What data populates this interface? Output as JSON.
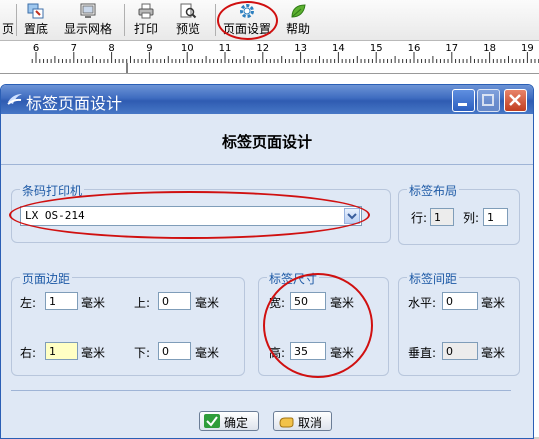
{
  "toolbar": {
    "items": [
      {
        "label": "页"
      },
      {
        "label": "置底"
      },
      {
        "label": "显示网格"
      },
      {
        "label": "打印"
      },
      {
        "label": "预览"
      },
      {
        "label": "页面设置"
      },
      {
        "label": "帮助"
      }
    ]
  },
  "ruler": {
    "numbers": [
      "6",
      "7",
      "8",
      "9",
      "10",
      "11",
      "12",
      "13",
      "14",
      "15",
      "16",
      "17",
      "18",
      "19"
    ]
  },
  "dialog": {
    "title": "标签页面设计",
    "header": "标签页面设计",
    "printer": {
      "title": "条码打印机",
      "selected": "LX OS-214"
    },
    "layout": {
      "title": "标签布局",
      "row_label": "行:",
      "row_value": "1",
      "col_label": "列:",
      "col_value": "1"
    },
    "margins": {
      "title": "页面边距",
      "left_label": "左:",
      "left_value": "1",
      "top_label": "上:",
      "top_value": "0",
      "right_label": "右:",
      "right_value": "1",
      "bottom_label": "下:",
      "bottom_value": "0",
      "unit": "毫米"
    },
    "size": {
      "title": "标签尺寸",
      "width_label": "宽:",
      "width_value": "50",
      "height_label": "高:",
      "height_value": "35",
      "unit": "毫米"
    },
    "spacing": {
      "title": "标签间距",
      "h_label": "水平:",
      "h_value": "0",
      "v_label": "垂直:",
      "v_value": "0",
      "unit": "毫米"
    },
    "ok_label": "确定",
    "cancel_label": "取消"
  },
  "colors": {
    "title_bar": "#3f6cc0",
    "dialog_bg": "#dfe8f5",
    "group_title": "#1e5aa6",
    "annotation": "#d01010"
  }
}
